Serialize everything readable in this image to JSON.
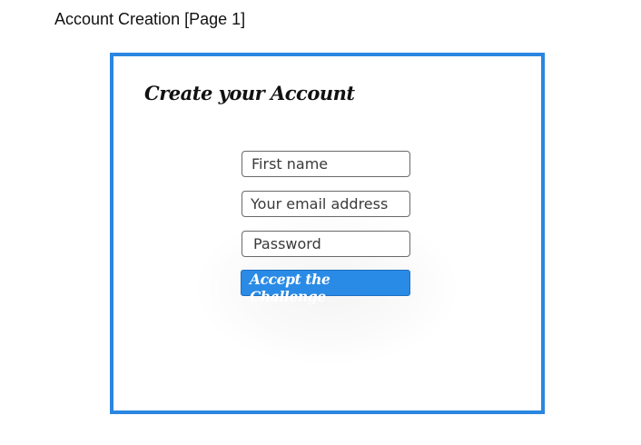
{
  "page": {
    "label": "Account Creation [Page 1]"
  },
  "form": {
    "title": "Create your Account",
    "first_name_placeholder": "First name",
    "email_placeholder": "Your email address",
    "password_placeholder": "Password",
    "submit_label": "Accept the Challenge"
  },
  "colors": {
    "frame_border": "#2a86e0",
    "button_background": "#2a8be6"
  }
}
